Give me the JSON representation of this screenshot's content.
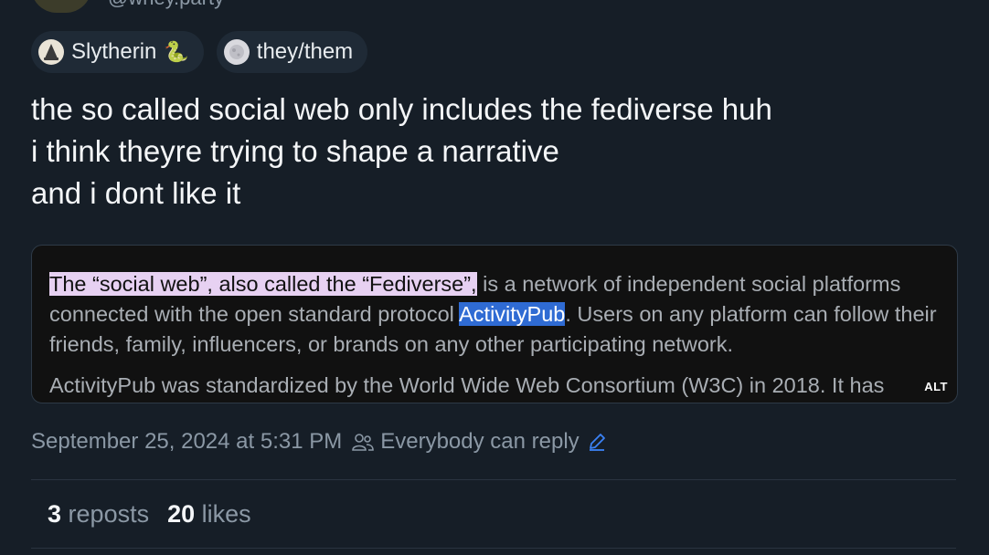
{
  "author": {
    "handle": "@whey.party"
  },
  "badges": [
    {
      "label": "Slytherin",
      "icon": "wizard-hat-icon",
      "emoji": "🐍"
    },
    {
      "label": "they/them",
      "icon": "moon-icon"
    }
  ],
  "post": {
    "lines": [
      "the so called social web only includes the fediverse huh",
      "i think theyre trying to shape a narrative",
      "and i dont like it"
    ]
  },
  "embed": {
    "highlight_pink": "The “social web”, also called the “Fediverse”,",
    "text_1": " is a network of independent social platforms connected with the open standard protocol ",
    "highlight_blue": "ActivityPub",
    "text_2": ". Users on any platform can follow their friends, family, influencers, or brands on any other participating network.",
    "paragraph_2": "ActivityPub was standardized by the World Wide Web Consortium (W3C) in 2018. It has",
    "alt_badge": "ALT",
    "colors": {
      "highlight_pink": "#e7d1f2",
      "highlight_blue": "#2f6bd3"
    }
  },
  "meta": {
    "timestamp": "September 25, 2024 at 5:31 PM",
    "reply_setting": "Everybody can reply"
  },
  "stats": {
    "reposts_count": "3",
    "reposts_label": "reposts",
    "likes_count": "20",
    "likes_label": "likes"
  },
  "theme": {
    "background": "#161e27",
    "accent": "#3b82f6",
    "muted": "#8b98a5"
  }
}
